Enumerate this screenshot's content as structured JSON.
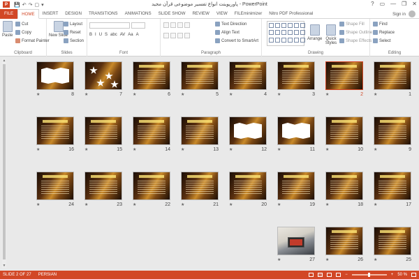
{
  "app": {
    "title": "پاورپوینت انواع تفسیر موضوعی قرآن مجید - PowerPoint",
    "logo_letter": "P",
    "qat": [
      "💾",
      "↶",
      "↷",
      "▢",
      "▾"
    ],
    "window_controls": [
      "?",
      "▭",
      "—",
      "❐",
      "✕"
    ]
  },
  "ribbon_tabs": {
    "file": "FILE",
    "items": [
      "HOME",
      "INSERT",
      "DESIGN",
      "TRANSITIONS",
      "ANIMATIONS",
      "SLIDE SHOW",
      "REVIEW",
      "VIEW",
      "FILEminimizer",
      "Nitro PDF Professional"
    ],
    "active": "HOME",
    "signin": "Sign in"
  },
  "ribbon": {
    "clipboard": {
      "paste": "Paste",
      "cut": "Cut",
      "copy": "Copy",
      "format_painter": "Format Painter",
      "label": "Clipboard"
    },
    "slides": {
      "new_slide": "New Slide",
      "layout": "Layout",
      "reset": "Reset",
      "section": "Section",
      "label": "Slides"
    },
    "font": {
      "label": "Font",
      "tools": [
        "B",
        "I",
        "U",
        "S",
        "abc",
        "AV",
        "Aa",
        "A"
      ]
    },
    "paragraph": {
      "label": "Paragraph",
      "text_direction": "Text Direction",
      "align_text": "Align Text",
      "convert": "Convert to SmartArt"
    },
    "drawing": {
      "label": "Drawing",
      "arrange": "Arrange",
      "quick_styles": "Quick Styles",
      "shape_fill": "Shape Fill",
      "shape_outline": "Shape Outline",
      "shape_effects": "Shape Effects"
    },
    "editing": {
      "label": "Editing",
      "find": "Find",
      "replace": "Replace",
      "select": "Select"
    }
  },
  "slides": [
    {
      "n": "1",
      "style": "text"
    },
    {
      "n": "2",
      "style": "text",
      "selected": true
    },
    {
      "n": "3",
      "style": "text"
    },
    {
      "n": "4",
      "style": "text"
    },
    {
      "n": "5",
      "style": "text"
    },
    {
      "n": "6",
      "style": "text"
    },
    {
      "n": "7",
      "style": "burst"
    },
    {
      "n": "8",
      "style": "white"
    },
    {
      "n": "9",
      "style": "text"
    },
    {
      "n": "10",
      "style": "text"
    },
    {
      "n": "11",
      "style": "white"
    },
    {
      "n": "12",
      "style": "white"
    },
    {
      "n": "13",
      "style": "text"
    },
    {
      "n": "14",
      "style": "text"
    },
    {
      "n": "15",
      "style": "text"
    },
    {
      "n": "16",
      "style": "text"
    },
    {
      "n": "17",
      "style": "text"
    },
    {
      "n": "18",
      "style": "text"
    },
    {
      "n": "19",
      "style": "text"
    },
    {
      "n": "20",
      "style": "text"
    },
    {
      "n": "21",
      "style": "text"
    },
    {
      "n": "22",
      "style": "text"
    },
    {
      "n": "23",
      "style": "text"
    },
    {
      "n": "24",
      "style": "text"
    },
    {
      "n": "25",
      "style": "text"
    },
    {
      "n": "26",
      "style": "text"
    },
    {
      "n": "27",
      "style": "photo"
    }
  ],
  "status": {
    "slide_info": "SLIDE 2 OF 27",
    "language": "PERSIAN",
    "zoom": "50 %",
    "zoom_minus": "−",
    "zoom_plus": "+",
    "zoom_level": 0.5
  },
  "colors": {
    "accent": "#d24726",
    "ribbon_bg": "#ffffff",
    "workspace_bg": "#e9e9e9"
  }
}
